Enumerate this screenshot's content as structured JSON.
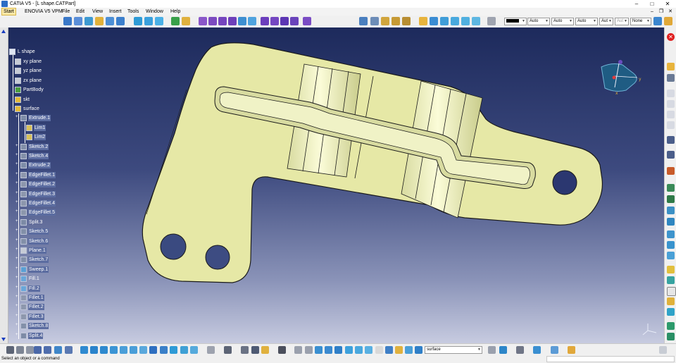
{
  "window": {
    "title": "CATIA V5 - [L shape.CATPart]",
    "minimize": "–",
    "maximize": "□",
    "close": "✕"
  },
  "menu": {
    "start": "Start",
    "items": [
      "ENOVIA V5 VPM",
      "File",
      "Edit",
      "View",
      "Insert",
      "Tools",
      "Window",
      "Help"
    ],
    "doc_min": "–",
    "doc_restore": "❐",
    "doc_close": "✕"
  },
  "toolbar": {
    "color_value": "",
    "linetype": "Auto",
    "thickness": "Auto",
    "pattern": "Auto",
    "layer_a": "Aut",
    "layer_b": "Aut",
    "render_style": "None"
  },
  "tree": {
    "root": "L shape",
    "items": [
      {
        "label": "xy plane",
        "icon": "plane-icon",
        "level": 1
      },
      {
        "label": "yz plane",
        "icon": "plane-icon",
        "level": 1
      },
      {
        "label": "zx plane",
        "icon": "plane-icon",
        "level": 1
      },
      {
        "label": "PartBody",
        "icon": "partbody-icon",
        "level": 1
      },
      {
        "label": "skt",
        "icon": "geometrical-set-icon",
        "level": 1
      },
      {
        "label": "surface",
        "icon": "geometrical-set-icon",
        "level": 1
      },
      {
        "label": "Extrude.1",
        "icon": "extrude-icon",
        "level": 2
      },
      {
        "label": "Lim1",
        "icon": "limit-icon",
        "level": 3
      },
      {
        "label": "Lim2",
        "icon": "limit-icon",
        "level": 3
      },
      {
        "label": "Sketch.2",
        "icon": "sketch-icon",
        "level": 2
      },
      {
        "label": "Sketch.4",
        "icon": "sketch-icon",
        "level": 2
      },
      {
        "label": "Extrude.2",
        "icon": "extrude-icon",
        "level": 2
      },
      {
        "label": "EdgeFillet.1",
        "icon": "fillet-icon",
        "level": 2
      },
      {
        "label": "EdgeFillet.2",
        "icon": "fillet-icon",
        "level": 2
      },
      {
        "label": "EdgeFillet.3",
        "icon": "fillet-icon",
        "level": 2
      },
      {
        "label": "EdgeFillet.4",
        "icon": "fillet-icon",
        "level": 2
      },
      {
        "label": "EdgeFillet.5",
        "icon": "fillet-icon",
        "level": 2
      },
      {
        "label": "Split.3",
        "icon": "split-icon",
        "level": 2
      },
      {
        "label": "Sketch.5",
        "icon": "sketch-icon",
        "level": 2
      },
      {
        "label": "Sketch.6",
        "icon": "sketch-icon",
        "level": 2
      },
      {
        "label": "Plane.1",
        "icon": "plane-icon",
        "level": 2
      },
      {
        "label": "Sketch.7",
        "icon": "sketch-icon",
        "level": 2
      },
      {
        "label": "Sweep.1",
        "icon": "sweep-icon",
        "level": 2
      },
      {
        "label": "Fill.1",
        "icon": "fill-icon",
        "level": 2
      },
      {
        "label": "Fill.2",
        "icon": "fill-icon",
        "level": 2
      },
      {
        "label": "Fillet.1",
        "icon": "fillet-icon",
        "level": 2
      },
      {
        "label": "Fillet.2",
        "icon": "fillet-icon",
        "level": 2
      },
      {
        "label": "Fillet.3",
        "icon": "fillet-icon",
        "level": 2
      },
      {
        "label": "Sketch.8",
        "icon": "sketch-icon",
        "level": 2
      },
      {
        "label": "Split.4",
        "icon": "split-icon",
        "level": 2
      }
    ]
  },
  "bottom": {
    "current_set": "surface"
  },
  "status": {
    "message": "Select an object or a command",
    "command": ""
  },
  "colors": {
    "viewport_top": "#1d2a5c",
    "viewport_bottom": "#c7cbe0",
    "part_fill": "#e6e8a6",
    "tree_text": "#ffffff"
  }
}
